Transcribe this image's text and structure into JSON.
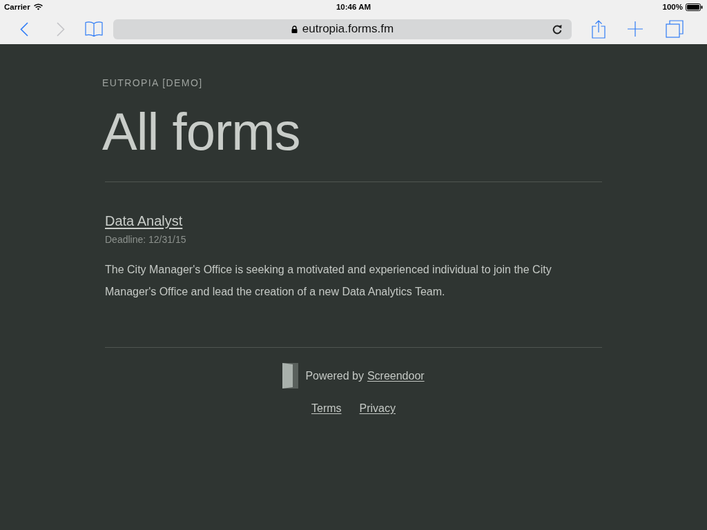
{
  "status_bar": {
    "carrier": "Carrier",
    "time": "10:46 AM",
    "battery": "100%"
  },
  "browser": {
    "back": {
      "disabled": false
    },
    "forward": {
      "disabled": true
    },
    "url": "eutropia.forms.fm"
  },
  "page": {
    "org": "EUTROPIA [DEMO]",
    "heading": "All forms",
    "forms": [
      {
        "title": "Data Analyst",
        "deadline": "Deadline: 12/31/15",
        "description": "The City Manager's Office is seeking a motivated and experienced individual to join the City Manager's Office and lead the creation of a new Data Analytics Team."
      }
    ]
  },
  "footer": {
    "powered_by": "Powered by",
    "brand_link": "Screendoor",
    "links": [
      "Terms",
      "Privacy"
    ]
  }
}
